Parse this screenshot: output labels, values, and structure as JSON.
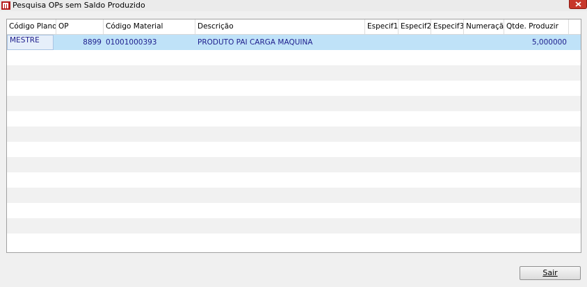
{
  "window": {
    "title": "Pesquisa OPs sem Saldo Produzido",
    "icon": "app-logo-icon",
    "close_icon": "close-icon"
  },
  "grid": {
    "columns": [
      {
        "key": "codigo_plano",
        "label": "Código Plano"
      },
      {
        "key": "op",
        "label": "OP"
      },
      {
        "key": "codigo_material",
        "label": "Código Material"
      },
      {
        "key": "descricao",
        "label": "Descrição"
      },
      {
        "key": "especif1",
        "label": "Especif1"
      },
      {
        "key": "especif2",
        "label": "Especif2"
      },
      {
        "key": "especif3",
        "label": "Especif3"
      },
      {
        "key": "numeracao",
        "label": "Numeração"
      },
      {
        "key": "qtde_produzir",
        "label": "Qtde. Produzir"
      }
    ],
    "rows": [
      {
        "codigo_plano": "MESTRE",
        "op": "8899",
        "codigo_material": "01001000393",
        "descricao": "PRODUTO PAI CARGA MAQUINA",
        "especif1": "",
        "especif2": "",
        "especif3": "",
        "numeracao": "",
        "qtde_produzir": "5,000000"
      }
    ],
    "selection_color": "#bfe2f8"
  },
  "footer": {
    "sair_label": "Sair"
  }
}
